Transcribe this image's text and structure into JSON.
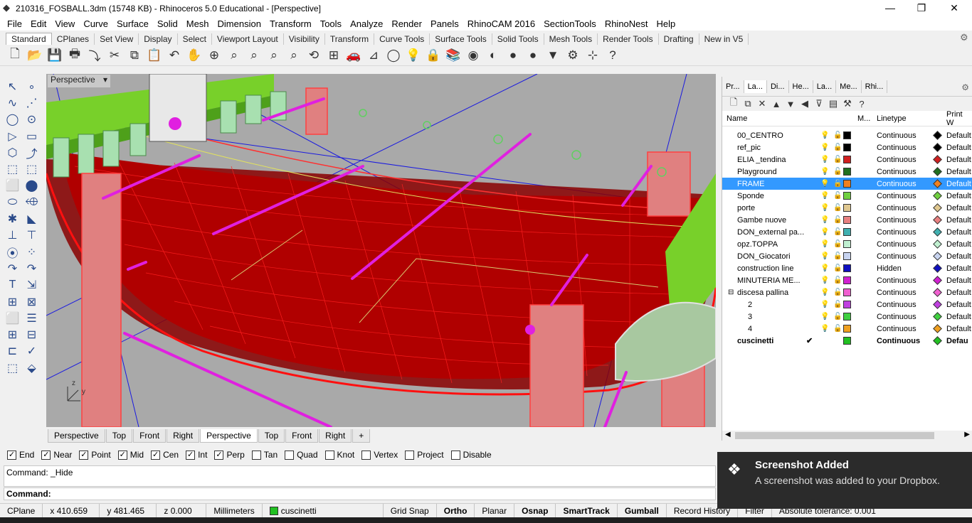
{
  "window": {
    "title": "210316_FOSBALL.3dm (15748 KB) - Rhinoceros 5.0 Educational - [Perspective]",
    "minimize": "—",
    "restore": "❐",
    "close": "✕"
  },
  "menu": [
    "File",
    "Edit",
    "View",
    "Curve",
    "Surface",
    "Solid",
    "Mesh",
    "Dimension",
    "Transform",
    "Tools",
    "Analyze",
    "Render",
    "Panels",
    "RhinoCAM 2016",
    "SectionTools",
    "RhinoNest",
    "Help"
  ],
  "toolbar_tabs": [
    "Standard",
    "CPlanes",
    "Set View",
    "Display",
    "Select",
    "Viewport Layout",
    "Visibility",
    "Transform",
    "Curve Tools",
    "Surface Tools",
    "Solid Tools",
    "Mesh Tools",
    "Render Tools",
    "Drafting",
    "New in V5"
  ],
  "toolbar_icons": [
    "new-file-icon",
    "open-icon",
    "save-icon",
    "print-icon",
    "import-icon",
    "cut-icon",
    "copy-icon",
    "paste-icon",
    "undo-icon",
    "pan-icon",
    "rotate-view-icon",
    "zoom-dynamic-icon",
    "zoom-window-icon",
    "zoom-extents-icon",
    "zoom-selected-icon",
    "rotate-icon",
    "four-viewports-icon",
    "car-icon",
    "cplane-icon",
    "ellipse-icon",
    "light-icon",
    "lock-icon",
    "layer-icon",
    "color-icon",
    "material-icon",
    "sphere-icon",
    "render-icon",
    "select-filter-icon",
    "settings-icon",
    "grip-icon",
    "help-icon"
  ],
  "toolbar_glyphs": [
    "🗋",
    "📂",
    "💾",
    "🖶",
    "⤵",
    "✂",
    "⧉",
    "📋",
    "↶",
    "✋",
    "⊕",
    "⌕",
    "⌕",
    "⌕",
    "⌕",
    "⟲",
    "⊞",
    "🚗",
    "⊿",
    "◯",
    "💡",
    "🔒",
    "📚",
    "◉",
    "◐",
    "●",
    "●",
    "▼",
    "⚙",
    "⊹",
    "?"
  ],
  "left_tools": [
    "↖",
    "∘",
    "∿",
    "⋰",
    "◯",
    "⊙",
    "▷",
    "▭",
    "⬡",
    "⤴",
    "⬚",
    "⬚",
    "⬜",
    "⬤",
    "⬭",
    "⬲",
    "✱",
    "◣",
    "⊥",
    "⊤",
    "⦿",
    "⁘",
    "↷",
    "↷",
    "T",
    "⇲",
    "⊞",
    "⊠",
    "⬜",
    "☰",
    "⊞",
    "⊟",
    "⊏",
    "✓",
    "⬚",
    "⬙"
  ],
  "viewport": {
    "label": "Perspective",
    "menu_glyph": "▾"
  },
  "viewport_tabs": [
    "Perspective",
    "Top",
    "Front",
    "Right",
    "Perspective",
    "Top",
    "Front",
    "Right",
    "+"
  ],
  "osnap": [
    {
      "label": "End",
      "checked": true
    },
    {
      "label": "Near",
      "checked": true
    },
    {
      "label": "Point",
      "checked": true
    },
    {
      "label": "Mid",
      "checked": true
    },
    {
      "label": "Cen",
      "checked": true
    },
    {
      "label": "Int",
      "checked": true
    },
    {
      "label": "Perp",
      "checked": true
    },
    {
      "label": "Tan",
      "checked": false
    },
    {
      "label": "Quad",
      "checked": false
    },
    {
      "label": "Knot",
      "checked": false
    },
    {
      "label": "Vertex",
      "checked": false
    },
    {
      "label": "Project",
      "checked": false
    },
    {
      "label": "Disable",
      "checked": false
    }
  ],
  "command": {
    "history": "Command: _Hide",
    "prompt": "Command:"
  },
  "status": {
    "cplane": "CPlane",
    "x": "x 410.659",
    "y": "y 481.465",
    "z": "z 0.000",
    "units": "Millimeters",
    "layer": "cuscinetti",
    "layer_color": "#22c022",
    "buttons": [
      "Grid Snap",
      "Ortho",
      "Planar",
      "Osnap",
      "SmartTrack",
      "Gumball",
      "Record History",
      "Filter"
    ],
    "bold": [
      "Ortho",
      "Osnap",
      "SmartTrack",
      "Gumball"
    ],
    "tolerance": "Absolute tolerance: 0.001"
  },
  "panel": {
    "tabs": [
      "Pr...",
      "La...",
      "Di...",
      "He...",
      "La...",
      "Me...",
      "Rhi..."
    ],
    "tools": [
      "🗋",
      "⧉",
      "✕",
      "▲",
      "▼",
      "◀",
      "⊽",
      "▤",
      "⚒",
      "?"
    ],
    "headers": {
      "name": "Name",
      "material": "M...",
      "linetype": "Linetype",
      "print": "Print W"
    },
    "layers": [
      {
        "name": "00_CENTRO",
        "color": "#000000",
        "linetype": "Continuous",
        "print": "Default",
        "dia": "#000000"
      },
      {
        "name": "ref_pic",
        "color": "#000000",
        "linetype": "Continuous",
        "print": "Default",
        "dia": "#000000"
      },
      {
        "name": "ELIA _tendina",
        "color": "#d02020",
        "linetype": "Continuous",
        "print": "Default",
        "dia": "#d02020"
      },
      {
        "name": "Playground",
        "color": "#207020",
        "linetype": "Continuous",
        "print": "Default",
        "dia": "#207020"
      },
      {
        "name": "FRAME",
        "color": "#f08020",
        "linetype": "Continuous",
        "print": "Default",
        "dia": "#f08020",
        "selected": true
      },
      {
        "name": "Sponde",
        "color": "#70d040",
        "linetype": "Continuous",
        "print": "Default",
        "dia": "#70d040"
      },
      {
        "name": "porte",
        "color": "#e0c890",
        "linetype": "Continuous",
        "print": "Default",
        "dia": "#e0c890"
      },
      {
        "name": "Gambe nuove",
        "color": "#e88080",
        "linetype": "Continuous",
        "print": "Default",
        "dia": "#e88080"
      },
      {
        "name": "DON_external pa...",
        "color": "#40b0b0",
        "linetype": "Continuous",
        "print": "Default",
        "dia": "#40b0b0"
      },
      {
        "name": "opz.TOPPA",
        "color": "#c0f0d0",
        "linetype": "Continuous",
        "print": "Default",
        "dia": "#c0f0d0"
      },
      {
        "name": "DON_Giocatori",
        "color": "#c8d4f0",
        "linetype": "Continuous",
        "print": "Default",
        "dia": "#c8d4f0"
      },
      {
        "name": "construction line",
        "color": "#1010c0",
        "linetype": "Hidden",
        "print": "Default",
        "dia": "#1010c0"
      },
      {
        "name": "MINUTERIA ME...",
        "color": "#d020d0",
        "linetype": "Continuous",
        "print": "Default",
        "dia": "#d020d0"
      },
      {
        "name": "discesa pallina",
        "color": "#f060d0",
        "linetype": "Continuous",
        "print": "Default",
        "dia": "#f060d0",
        "expander": "⊟"
      },
      {
        "name": "2",
        "color": "#c040e0",
        "linetype": "Continuous",
        "print": "Default",
        "dia": "#c040e0",
        "indent": true
      },
      {
        "name": "3",
        "color": "#40d040",
        "linetype": "Continuous",
        "print": "Default",
        "dia": "#40d040",
        "indent": true
      },
      {
        "name": "4",
        "color": "#f0a020",
        "linetype": "Continuous",
        "print": "Default",
        "dia": "#f0a020",
        "indent": true
      },
      {
        "name": "cuscinetti",
        "color": "#22c022",
        "linetype": "Continuous",
        "print": "Defau",
        "dia": "#22c022",
        "current": true,
        "check": "✔"
      }
    ]
  },
  "toast": {
    "title": "Screenshot Added",
    "body": "A screenshot was added to your Dropbox.",
    "icon": "dropbox-icon"
  },
  "colors": {
    "frame_red": "#cc0000",
    "magenta": "#e020e0",
    "green": "#70d040",
    "selection": "#3399ff"
  }
}
